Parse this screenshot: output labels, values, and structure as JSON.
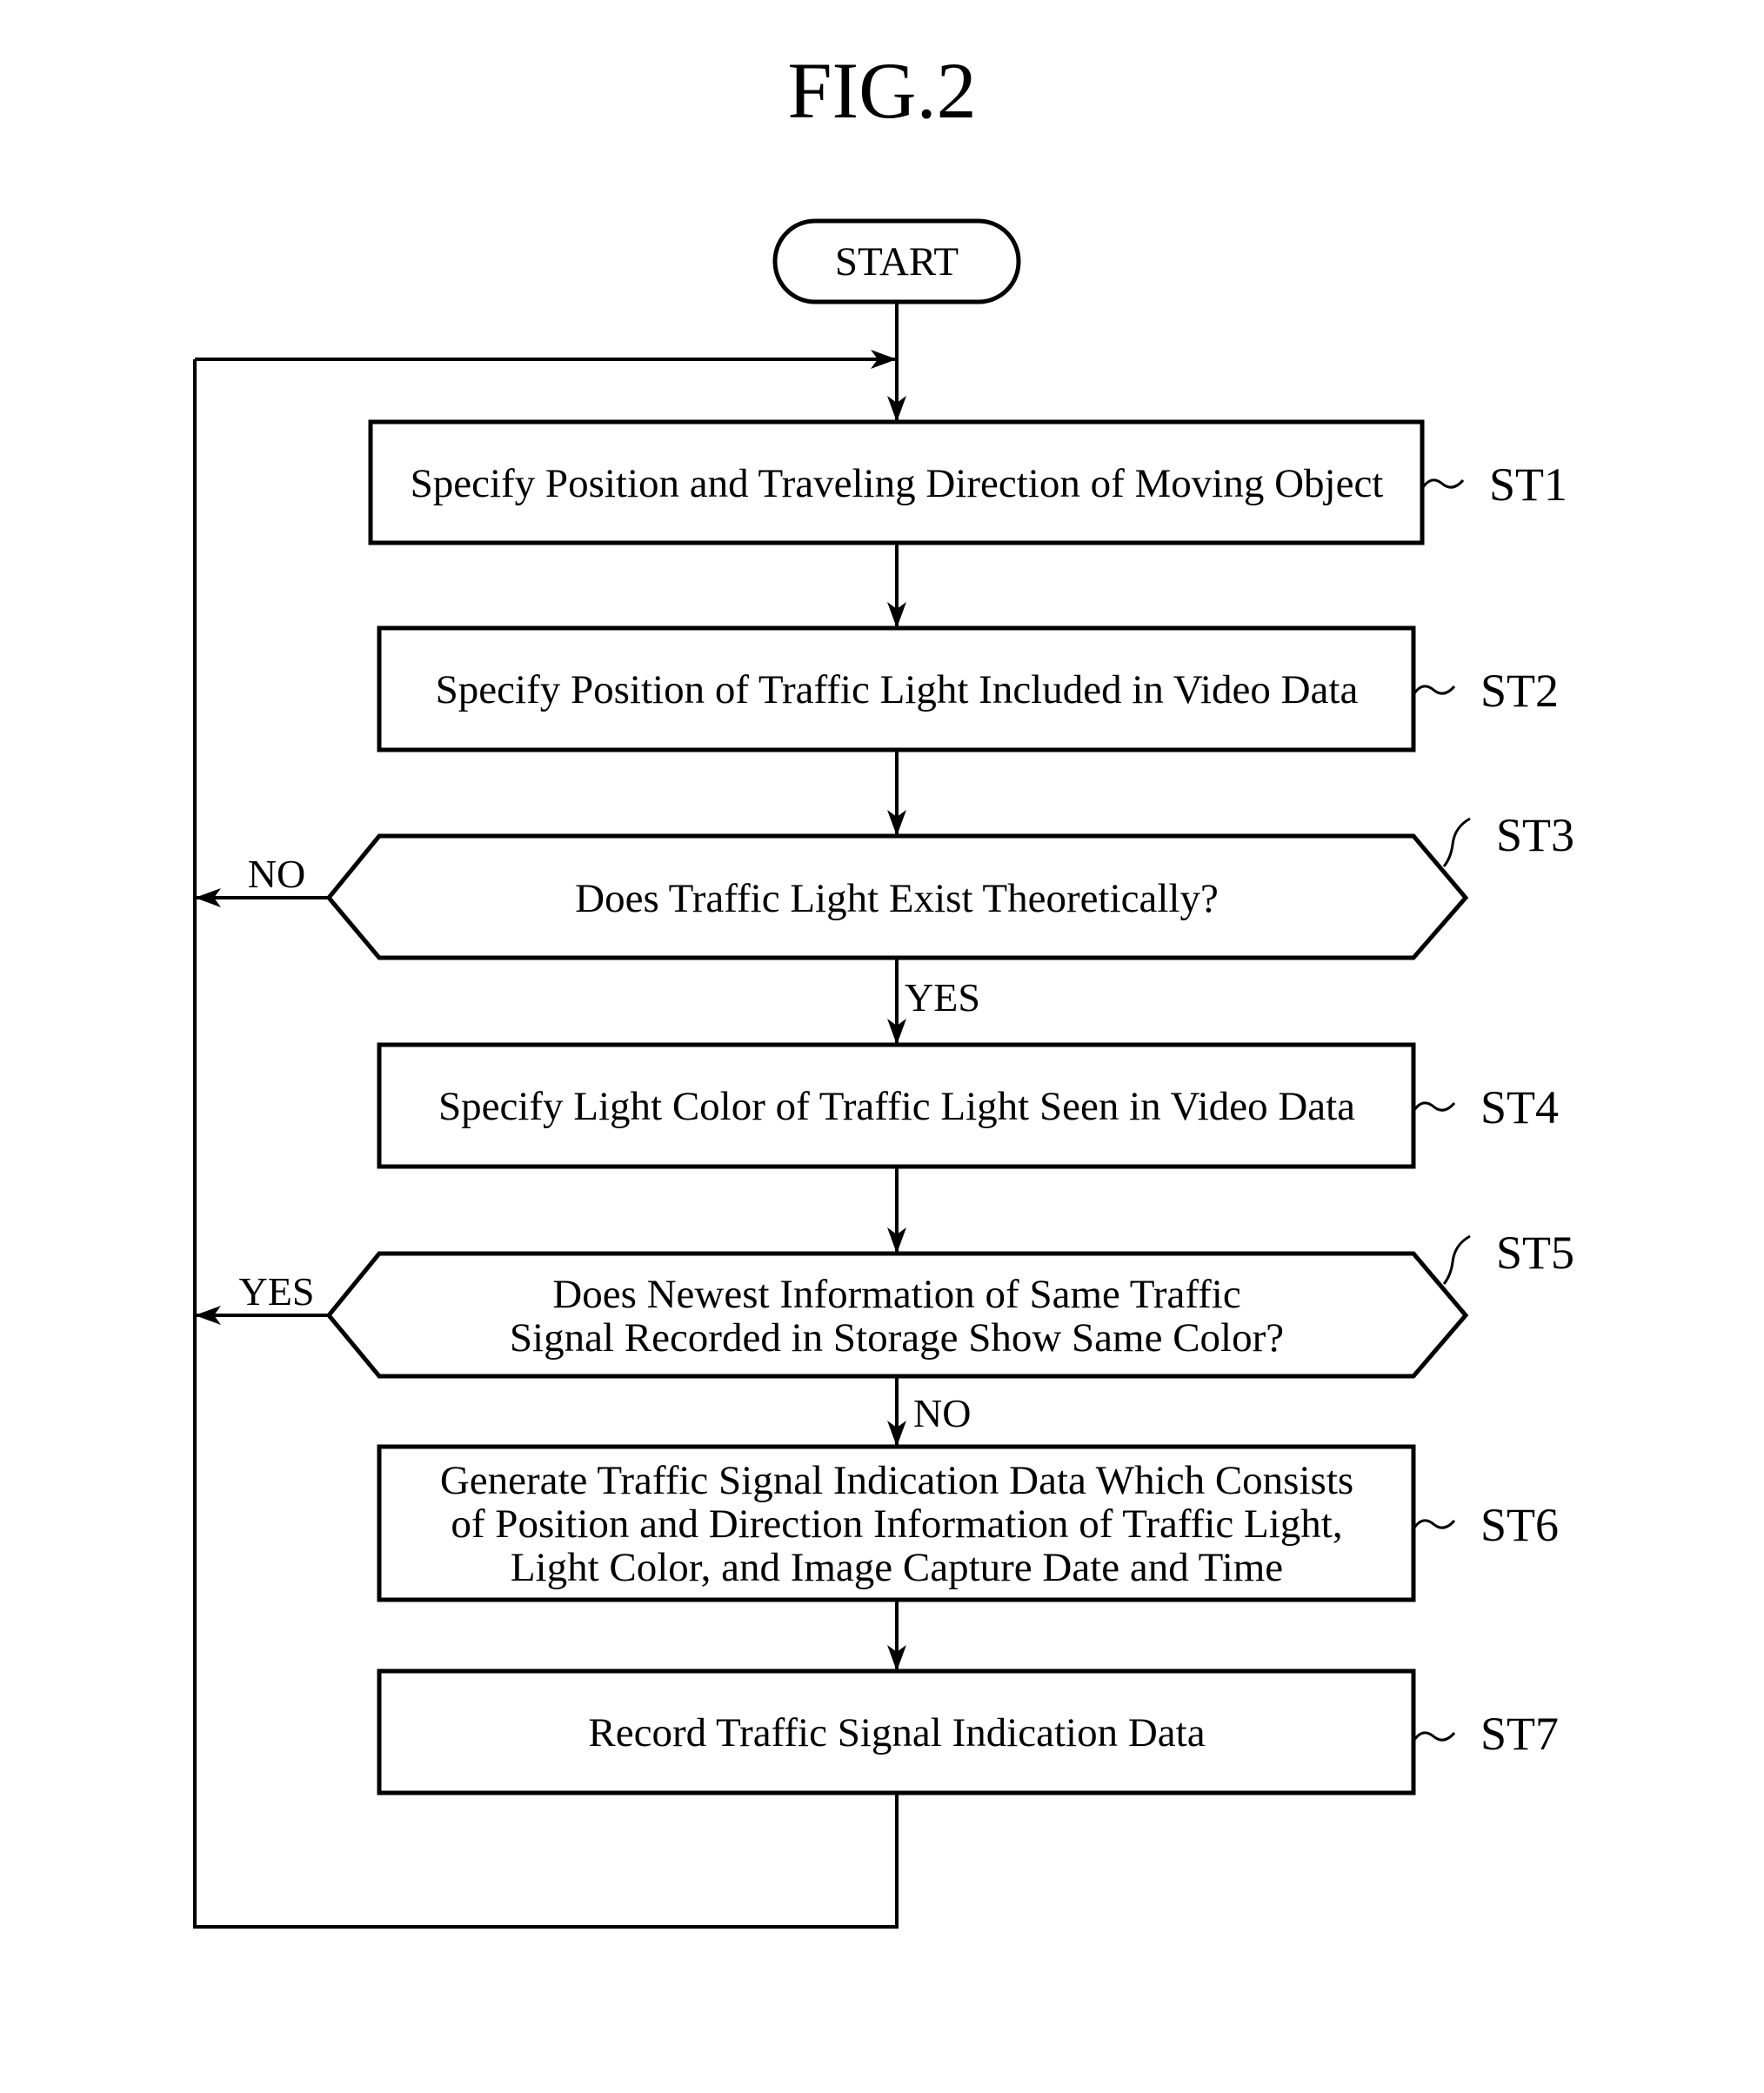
{
  "figure": {
    "title": "FIG.2",
    "start_label": "START",
    "steps": [
      {
        "id": "ST1",
        "type": "process",
        "lines": [
          "Specify Position and Traveling Direction of Moving Object"
        ]
      },
      {
        "id": "ST2",
        "type": "process",
        "lines": [
          "Specify Position of Traffic Light Included in Video Data"
        ]
      },
      {
        "id": "ST3",
        "type": "decision",
        "lines": [
          "Does Traffic Light Exist Theoretically?"
        ],
        "left_branch": "NO",
        "down_branch": "YES"
      },
      {
        "id": "ST4",
        "type": "process",
        "lines": [
          "Specify Light Color of Traffic Light Seen in Video Data"
        ]
      },
      {
        "id": "ST5",
        "type": "decision",
        "lines": [
          "Does Newest Information of Same Traffic",
          "Signal Recorded in Storage Show Same Color?"
        ],
        "left_branch": "YES",
        "down_branch": "NO"
      },
      {
        "id": "ST6",
        "type": "process",
        "lines": [
          "Generate Traffic Signal Indication Data Which Consists",
          "of Position and Direction Information of Traffic Light,",
          "Light Color, and Image Capture Date and Time"
        ]
      },
      {
        "id": "ST7",
        "type": "process",
        "lines": [
          "Record Traffic Signal Indication Data"
        ]
      }
    ]
  }
}
